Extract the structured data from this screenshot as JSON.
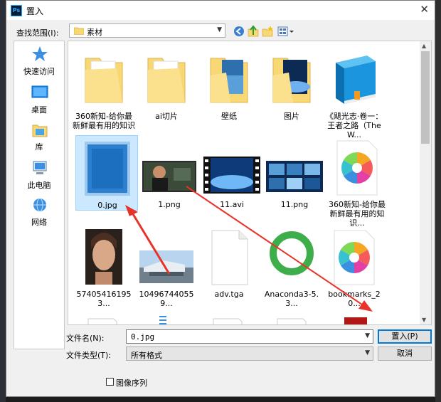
{
  "dialog": {
    "title": "置入",
    "close_glyph": "✕",
    "app_icon_text": "Ps"
  },
  "lookin": {
    "label": "查找范围(I):",
    "value": "素材"
  },
  "toolbar": {
    "back_icon": "back-icon",
    "up_icon": "up-folder-icon",
    "new_folder_icon": "new-folder-icon",
    "view_icon": "view-menu-icon"
  },
  "places": [
    {
      "label": "快速访问",
      "icon": "star-icon"
    },
    {
      "label": "桌面",
      "icon": "desktop-icon"
    },
    {
      "label": "库",
      "icon": "library-icon"
    },
    {
      "label": "此电脑",
      "icon": "computer-icon"
    },
    {
      "label": "网络",
      "icon": "network-icon"
    }
  ],
  "files": [
    {
      "label": "360新知-给你最新鲜最有用的知识_...",
      "kind": "folder"
    },
    {
      "label": "ai切片",
      "kind": "folder"
    },
    {
      "label": "壁纸",
      "kind": "folder-image"
    },
    {
      "label": "图片",
      "kind": "folder-image"
    },
    {
      "label": "《飓光志·卷一：王者之路（The W...",
      "kind": "book"
    },
    {
      "label": "0.jpg",
      "kind": "image-blue"
    },
    {
      "label": "1.png",
      "kind": "image-video"
    },
    {
      "label": "11.avi",
      "kind": "video"
    },
    {
      "label": "11.png",
      "kind": "image-collage"
    },
    {
      "label": "360新知-给你最新鲜最有用的知识...",
      "kind": "pinwheel"
    },
    {
      "label": "574054161953...",
      "kind": "portrait"
    },
    {
      "label": "104967440559...",
      "kind": "photo-building"
    },
    {
      "label": "adv.tga",
      "kind": "blank-doc"
    },
    {
      "label": "Anaconda3-5.3...",
      "kind": "anaconda"
    },
    {
      "label": "bookmarks_20...",
      "kind": "pinwheel"
    }
  ],
  "filename": {
    "label": "文件名(N):",
    "value": "0.jpg"
  },
  "filetype": {
    "label": "文件类型(T):",
    "value": "所有格式"
  },
  "buttons": {
    "place": "置入(P)",
    "cancel": "取消"
  },
  "sequence": {
    "label": "图像序列",
    "checked": false
  },
  "colors": {
    "annotation_arrow": "#e8332a",
    "selection": "#cce8ff",
    "folder": "#f8d775"
  }
}
